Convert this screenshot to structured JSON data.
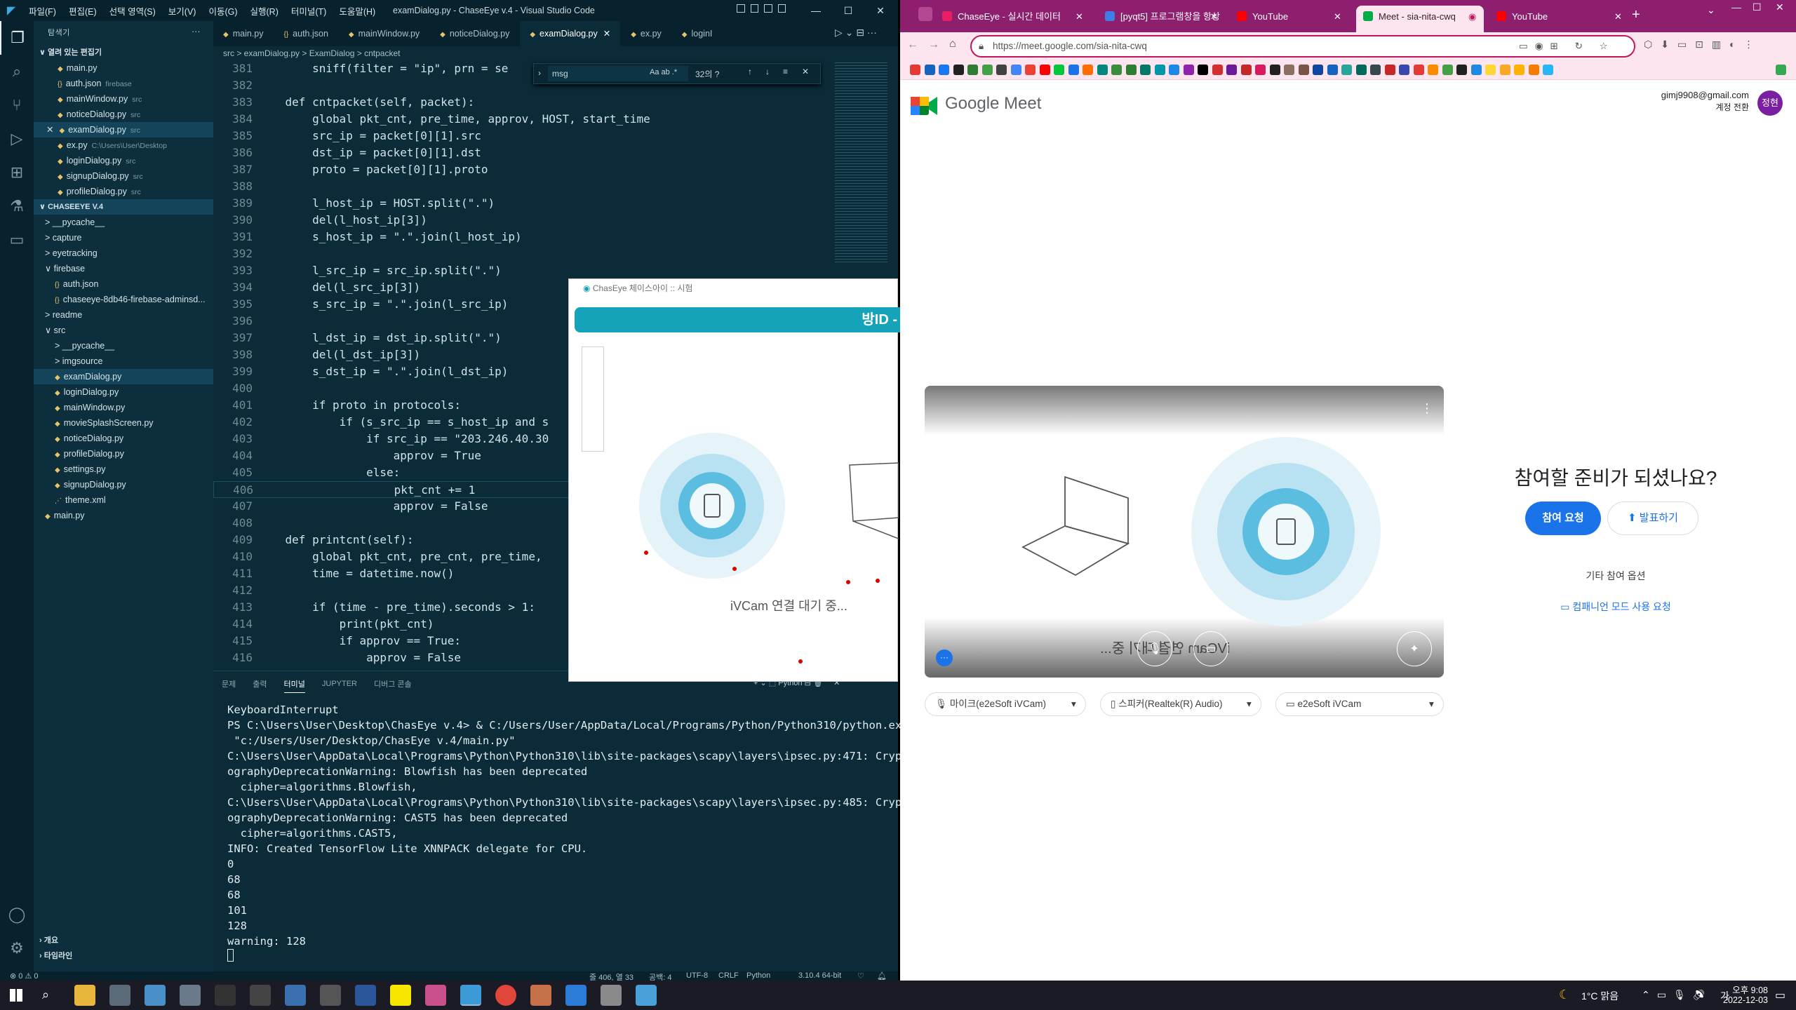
{
  "vscode": {
    "menu": [
      "파일(F)",
      "편집(E)",
      "선택 영역(S)",
      "보기(V)",
      "이동(G)",
      "실행(R)",
      "터미널(T)",
      "도움말(H)"
    ],
    "title": "examDialog.py - ChaseEye v.4 - Visual Studio Code",
    "explorer_header": "탐색기",
    "open_editors_label": "열려 있는 편집기",
    "open_editors": [
      {
        "name": "main.py",
        "hint": ""
      },
      {
        "name": "auth.json",
        "hint": "firebase"
      },
      {
        "name": "mainWindow.py",
        "hint": "src"
      },
      {
        "name": "noticeDialog.py",
        "hint": "src"
      },
      {
        "name": "examDialog.py",
        "hint": "src"
      },
      {
        "name": "ex.py",
        "hint": "C:\\Users\\User\\Desktop"
      },
      {
        "name": "loginDialog.py",
        "hint": "src"
      },
      {
        "name": "signupDialog.py",
        "hint": "src"
      },
      {
        "name": "profileDialog.py",
        "hint": "src"
      }
    ],
    "project_label": "CHASEEYE V.4",
    "project_tree": [
      "> __pycache__",
      "> capture",
      "> eyetracking",
      "∨ firebase",
      "auth.json",
      "chaseeye-8db46-firebase-adminsd...",
      "> readme",
      "∨ src",
      "> __pycache__",
      "> imgsource",
      "examDialog.py",
      "loginDialog.py",
      "mainWindow.py",
      "movieSplashScreen.py",
      "noticeDialog.py",
      "profileDialog.py",
      "settings.py",
      "signupDialog.py",
      "theme.xml",
      "main.py"
    ],
    "outline_label": "개요",
    "timeline_label": "타임라인",
    "tabs": [
      "main.py",
      "auth.json",
      "mainWindow.py",
      "noticeDialog.py",
      "examDialog.py",
      "ex.py",
      "loginI"
    ],
    "breadcrumb": "src  >  examDialog.py  >  ExamDialog  >  cntpacket",
    "find": {
      "value": "msg",
      "result": "32의 ?"
    },
    "code_lines": [
      {
        "n": "381",
        "t": "        sniff(filter = \"ip\", prn = se"
      },
      {
        "n": "382",
        "t": ""
      },
      {
        "n": "383",
        "t": "    def cntpacket(self, packet):"
      },
      {
        "n": "384",
        "t": "        global pkt_cnt, pre_time, approv, HOST, start_time"
      },
      {
        "n": "385",
        "t": "        src_ip = packet[0][1].src"
      },
      {
        "n": "386",
        "t": "        dst_ip = packet[0][1].dst"
      },
      {
        "n": "387",
        "t": "        proto = packet[0][1].proto"
      },
      {
        "n": "388",
        "t": ""
      },
      {
        "n": "389",
        "t": "        l_host_ip = HOST.split(\".\")"
      },
      {
        "n": "390",
        "t": "        del(l_host_ip[3])"
      },
      {
        "n": "391",
        "t": "        s_host_ip = \".\".join(l_host_ip)"
      },
      {
        "n": "392",
        "t": ""
      },
      {
        "n": "393",
        "t": "        l_src_ip = src_ip.split(\".\")"
      },
      {
        "n": "394",
        "t": "        del(l_src_ip[3])"
      },
      {
        "n": "395",
        "t": "        s_src_ip = \".\".join(l_src_ip)"
      },
      {
        "n": "396",
        "t": ""
      },
      {
        "n": "397",
        "t": "        l_dst_ip = dst_ip.split(\".\")"
      },
      {
        "n": "398",
        "t": "        del(l_dst_ip[3])"
      },
      {
        "n": "399",
        "t": "        s_dst_ip = \".\".join(l_dst_ip)"
      },
      {
        "n": "400",
        "t": ""
      },
      {
        "n": "401",
        "t": "        if proto in protocols:"
      },
      {
        "n": "402",
        "t": "            if (s_src_ip == s_host_ip and s"
      },
      {
        "n": "403",
        "t": "                if src_ip == \"203.246.40.30"
      },
      {
        "n": "404",
        "t": "                    approv = True"
      },
      {
        "n": "405",
        "t": "                else:"
      },
      {
        "n": "406",
        "t": "                    pkt_cnt += 1"
      },
      {
        "n": "407",
        "t": "                    approv = False"
      },
      {
        "n": "408",
        "t": ""
      },
      {
        "n": "409",
        "t": "    def printcnt(self):"
      },
      {
        "n": "410",
        "t": "        global pkt_cnt, pre_cnt, pre_time,"
      },
      {
        "n": "411",
        "t": "        time = datetime.now()"
      },
      {
        "n": "412",
        "t": ""
      },
      {
        "n": "413",
        "t": "        if (time - pre_time).seconds > 1:"
      },
      {
        "n": "414",
        "t": "            print(pkt_cnt)"
      },
      {
        "n": "415",
        "t": "            if approv == True:"
      },
      {
        "n": "416",
        "t": "                approv = False"
      }
    ],
    "panel_tabs": [
      "문제",
      "출력",
      "터미널",
      "JUPYTER",
      "디버그 콘솔"
    ],
    "panel_right": "Python",
    "terminal_lines": [
      "KeyboardInterrupt",
      "PS C:\\Users\\User\\Desktop\\ChasEye v.4> & C:/Users/User/AppData/Local/Programs/Python/Python310/python.exe",
      " \"c:/Users/User/Desktop/ChasEye v.4/main.py\"",
      "C:\\Users\\User\\AppData\\Local\\Programs\\Python\\Python310\\lib\\site-packages\\scapy\\layers\\ipsec.py:471: Crypt",
      "ographyDeprecationWarning: Blowfish has been deprecated",
      "  cipher=algorithms.Blowfish,",
      "C:\\Users\\User\\AppData\\Local\\Programs\\Python\\Python310\\lib\\site-packages\\scapy\\layers\\ipsec.py:485: Crypt",
      "ographyDeprecationWarning: CAST5 has been deprecated",
      "  cipher=algorithms.CAST5,",
      "INFO: Created TensorFlow Lite XNNPACK delegate for CPU.",
      "0",
      "68",
      "68",
      "101",
      "128",
      "warning: 128"
    ],
    "status": {
      "errors": "⊗ 0 ⚠ 0",
      "position": "줄 406, 열 33",
      "spaces": "공백: 4",
      "encoding": "UTF-8",
      "eol": "CRLF",
      "lang": "Python",
      "version": "3.10.4 64-bit"
    }
  },
  "chaseeye": {
    "title": "ChasEye 체이스아이 :: 시험",
    "room_label": "방ID -",
    "waiting": "iVCam 연결 대기 중..."
  },
  "chrome": {
    "tabs": [
      {
        "label": "ChaseEye - 실시간 데이터",
        "active": false
      },
      {
        "label": "[pyqt5] 프로그램창을 항상",
        "active": false
      },
      {
        "label": "YouTube",
        "active": false
      },
      {
        "label": "Meet - sia-nita-cwq",
        "active": true
      },
      {
        "label": "YouTube",
        "active": false
      }
    ],
    "url": "https://meet.google.com/sia-nita-cwq"
  },
  "meet": {
    "brand": "Google Meet",
    "account_email": "gimj9908@gmail.com",
    "switch_account": "계정 전환",
    "avatar_text": "정현",
    "preview_text": "iVCam 연결 대기 중...",
    "ready_heading": "참여할 준비가 되셨나요?",
    "join_button": "참여 요청",
    "present_button": "발표하기",
    "other_options": "기타 참여 옵션",
    "companion": "컴패니언 모드 사용 요청",
    "devices": {
      "mic": "마이크(e2eSoft iVCam)",
      "speaker": "스피커(Realtek(R) Audio)",
      "camera": "e2eSoft iVCam"
    }
  },
  "taskbar": {
    "weather": "1°C 맑음",
    "ime": "가",
    "time": "오후 9:08",
    "date": "2022-12-03"
  },
  "colors": {
    "vscode_bg": "#0b2b38",
    "chrome_frame": "#8e1f6f",
    "meet_blue": "#1a73e8",
    "chase_bar": "#14a3b8"
  }
}
